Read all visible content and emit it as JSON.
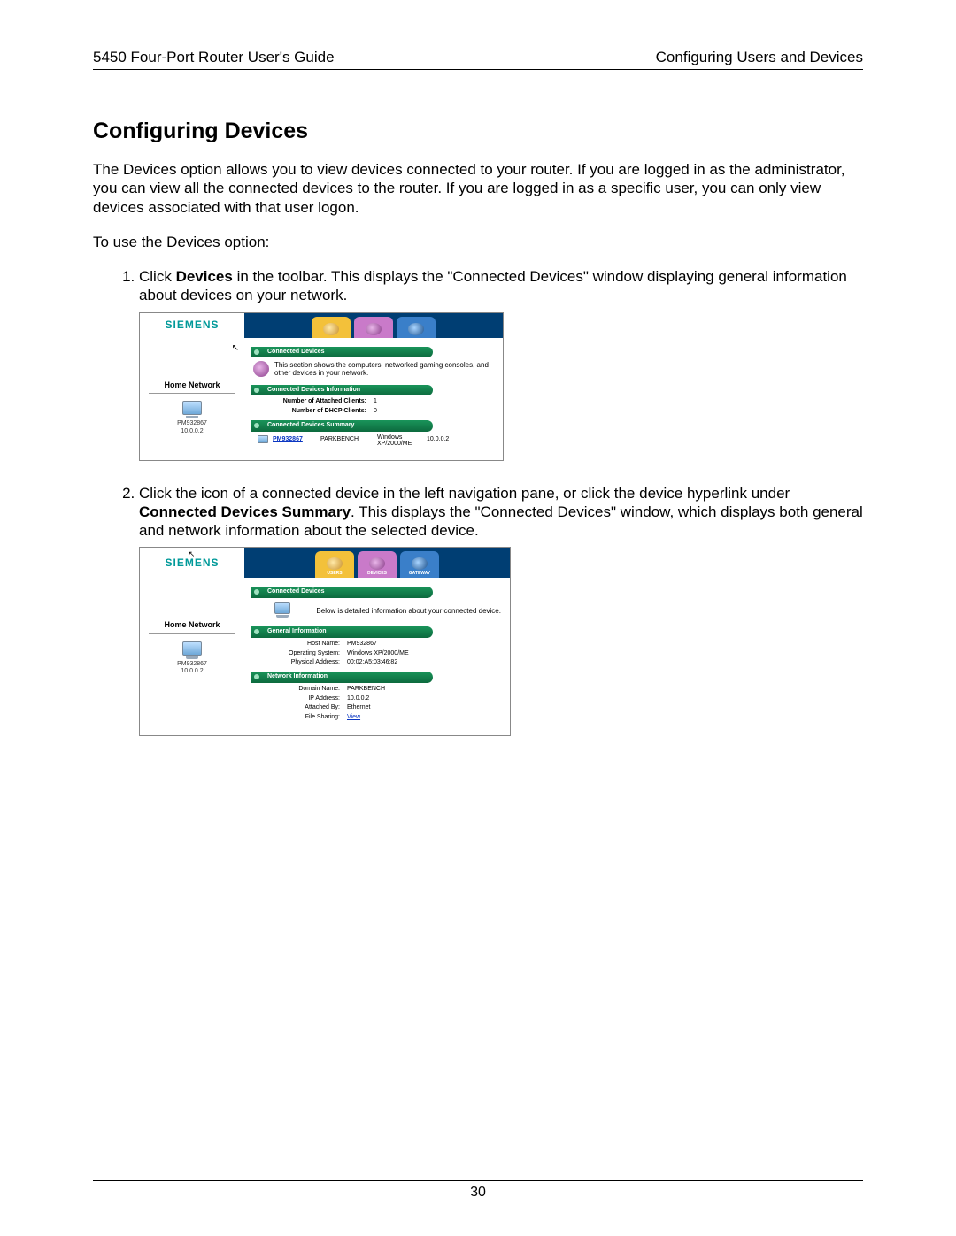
{
  "header": {
    "left": "5450 Four-Port Router User's Guide",
    "right": "Configuring Users and Devices"
  },
  "title": "Configuring Devices",
  "intro": "The Devices option allows you to view devices connected to your router. If you are logged in as the administrator, you can view all the connected devices to the router. If you are logged in as a specific user, you can only view devices associated with that user logon.",
  "lead": "To use the Devices option:",
  "step1": {
    "pre": "Click ",
    "bold": "Devices",
    "post": " in the toolbar. This displays the \"Connected Devices\" window displaying general information about devices on your network."
  },
  "step2": {
    "pre": "Click the icon of a connected device in the left navigation pane, or click the device hyperlink under ",
    "bold": "Connected Devices Summary",
    "post": ". This displays the \"Connected Devices\" window, which displays both general and network information about the selected device."
  },
  "logo": "SIEMENS",
  "tabs": {
    "users": "USERS",
    "devices": "DEVICES",
    "gateway": "GATEWAY"
  },
  "sidebar": {
    "home_network": "Home Network",
    "dev": {
      "name": "PM932867",
      "ip": "10.0.0.2"
    }
  },
  "shot1": {
    "p1": "Connected Devices",
    "desc": "This section shows the computers, networked gaming consoles, and other devices in your network.",
    "p2": "Connected Devices Information",
    "kv1": {
      "k": "Number of Attached Clients:",
      "v": "1"
    },
    "kv2": {
      "k": "Number of DHCP Clients:",
      "v": "0"
    },
    "p3": "Connected Devices Summary",
    "row": {
      "name": "PM932867",
      "c2": "PARKBENCH",
      "c3": "Windows XP/2000/ME",
      "c4": "10.0.0.2"
    }
  },
  "shot2": {
    "p1": "Connected Devices",
    "desc": "Below is detailed information about your connected device.",
    "p2": "General Information",
    "g": {
      "host_k": "Host Name:",
      "host_v": "PM932867",
      "os_k": "Operating System:",
      "os_v": "Windows XP/2000/ME",
      "pa_k": "Physical Address:",
      "pa_v": "00:02:A5:03:46:82"
    },
    "p3": "Network Information",
    "n": {
      "dn_k": "Domain Name:",
      "dn_v": "PARKBENCH",
      "ip_k": "IP Address:",
      "ip_v": "10.0.0.2",
      "ab_k": "Attached By:",
      "ab_v": "Ethernet",
      "fs_k": "File Sharing:",
      "fs_v": "View"
    }
  },
  "page_number": "30"
}
